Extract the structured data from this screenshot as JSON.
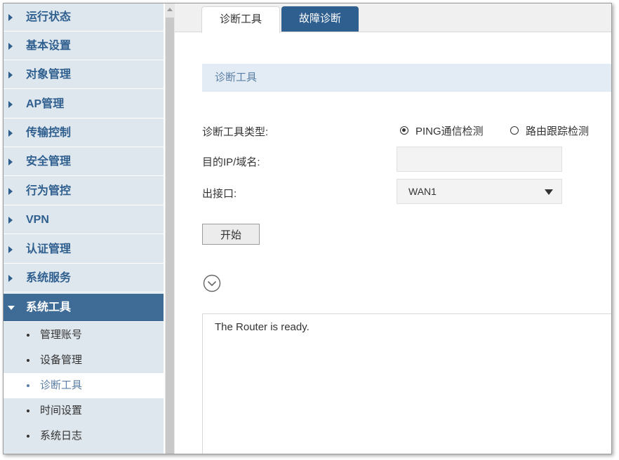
{
  "sidebar": {
    "menu": [
      {
        "label": "运行状态"
      },
      {
        "label": "基本设置"
      },
      {
        "label": "对象管理"
      },
      {
        "label": "AP管理"
      },
      {
        "label": "传输控制"
      },
      {
        "label": "安全管理"
      },
      {
        "label": "行为管控"
      },
      {
        "label": "VPN"
      },
      {
        "label": "认证管理"
      },
      {
        "label": "系统服务"
      },
      {
        "label": "系统工具"
      }
    ],
    "submenu": [
      {
        "label": "管理账号"
      },
      {
        "label": "设备管理"
      },
      {
        "label": "诊断工具"
      },
      {
        "label": "时间设置"
      },
      {
        "label": "系统日志"
      }
    ],
    "active_menu": "系统工具",
    "selected_submenu": "诊断工具"
  },
  "tabs": {
    "diagnostic": "诊断工具",
    "fault": "故障诊断"
  },
  "section": {
    "title": "诊断工具"
  },
  "form": {
    "type_label": "诊断工具类型:",
    "ping_option": "PING通信检测",
    "trace_option": "路由跟踪检测",
    "selected_option": "PING通信检测",
    "target_label": "目的IP/域名:",
    "target_value": "",
    "interface_label": "出接口:",
    "interface_value": "WAN1",
    "start_button": "开始"
  },
  "output": {
    "text": "The Router is ready."
  },
  "colors": {
    "sidebar_bg": "#dfe7ee",
    "active_menu_bg": "#3f6c97",
    "tab_active_bg": "#2f5f8f",
    "section_bg": "#e3ecf4"
  }
}
